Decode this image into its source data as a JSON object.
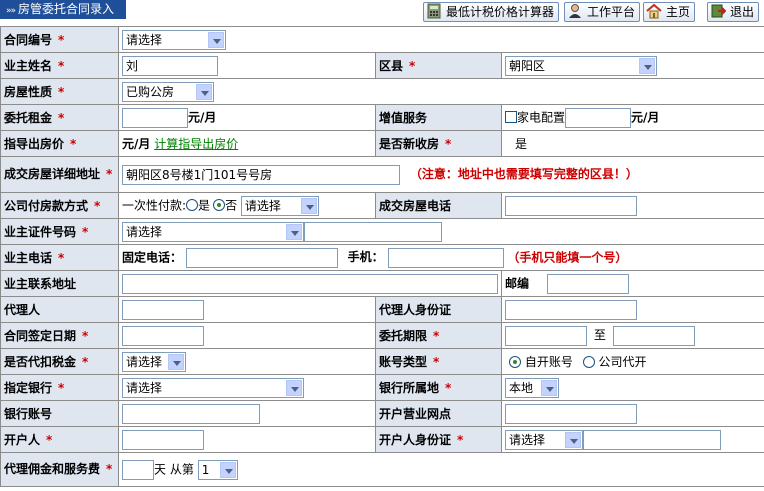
{
  "header": {
    "title": "房管委托合同录入",
    "buttons": {
      "calc": "最低计税价格计算器",
      "workbench": "工作平台",
      "home": "主页",
      "exit": "退出"
    }
  },
  "form": {
    "contract_no": {
      "label": "合同编号",
      "value": "请选择"
    },
    "owner_name": {
      "label": "业主姓名",
      "value": "刘"
    },
    "district": {
      "label": "区县",
      "value": "朝阳区"
    },
    "property_type": {
      "label": "房屋性质",
      "value": "已购公房"
    },
    "rent": {
      "label": "委托租金",
      "unit": "元/月"
    },
    "value_added": {
      "label": "增值服务",
      "appliance": "家电配置",
      "unit": "元/月"
    },
    "guide_price": {
      "label": "指导出房价",
      "unit": "元/月",
      "link": "计算指导出房价"
    },
    "new_intake": {
      "label": "是否新收房",
      "value": "是"
    },
    "address": {
      "label": "成交房屋详细地址",
      "value": "朝阳区8号楼1门101号号房",
      "hint": "（注意：地址中也需要填写完整的区县！）"
    },
    "payment": {
      "label": "公司付房款方式",
      "lump_label": "一次性付款:",
      "yes": "是",
      "no": "否",
      "select": "请选择"
    },
    "house_phone": {
      "label": "成交房屋电话"
    },
    "id_no": {
      "label": "业主证件号码",
      "select": "请选择"
    },
    "phone": {
      "label": "业主电话",
      "landline": "固定电话：",
      "mobile": "手机：",
      "hint": "（手机只能填一个号）"
    },
    "contact_addr": {
      "label": "业主联系地址",
      "postcode": "邮编"
    },
    "agent": {
      "label": "代理人"
    },
    "agent_id": {
      "label": "代理人身份证"
    },
    "sign_date": {
      "label": "合同签定日期"
    },
    "term": {
      "label": "委托期限",
      "to": "至"
    },
    "withhold_tax": {
      "label": "是否代扣税金",
      "value": "请选择"
    },
    "account_type": {
      "label": "账号类型",
      "self": "自开账号",
      "company": "公司代开"
    },
    "bank": {
      "label": "指定银行",
      "value": "请选择"
    },
    "bank_location": {
      "label": "银行所属地",
      "value": "本地"
    },
    "account_no": {
      "label": "银行账号"
    },
    "branch": {
      "label": "开户营业网点"
    },
    "holder": {
      "label": "开户人"
    },
    "holder_id": {
      "label": "开户人身份证",
      "select": "请选择"
    },
    "commission": {
      "label": "代理佣金和服务费",
      "days": "天",
      "from": "从第",
      "value": "1"
    }
  },
  "colors": {
    "label_bg": "#dfe6f0",
    "required": "#cc0000",
    "title_bg": "#1f4f99",
    "link": "#008000"
  }
}
